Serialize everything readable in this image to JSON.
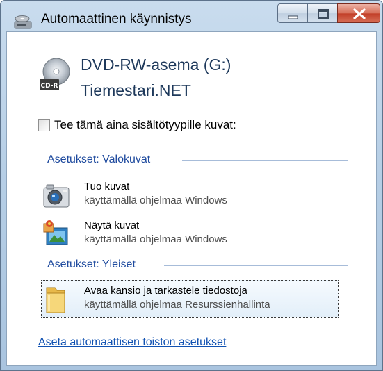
{
  "window": {
    "title": "Automaattinen käynnistys",
    "title_icon": "autoplay-icon",
    "buttons": {
      "minimize": "minimize-icon",
      "maximize": "maximize-icon",
      "close": "close-icon"
    }
  },
  "device": {
    "icon": "cd-r-disc-icon",
    "icon_badge": "CD-R",
    "drive_name": "DVD-RW-asema (G:)",
    "disc_name": "Tiemestari.NET"
  },
  "always_checkbox": {
    "label": "Tee tämä aina sisältötyypille kuvat:",
    "checked": false
  },
  "sections": [
    {
      "heading": "Asetukset: Valokuvat",
      "options": [
        {
          "icon": "camera-icon",
          "title": "Tuo kuvat",
          "subtitle": "käyttämällä ohjelmaa Windows"
        },
        {
          "icon": "photo-gallery-icon",
          "title": "Näytä kuvat",
          "subtitle": "käyttämällä ohjelmaa Windows"
        }
      ]
    },
    {
      "heading": "Asetukset: Yleiset",
      "options": [
        {
          "icon": "folder-icon",
          "title": "Avaa kansio ja tarkastele tiedostoja",
          "subtitle": "käyttämällä ohjelmaa Resurssienhallinta",
          "selected": true
        }
      ]
    }
  ],
  "footer_link": "Aseta automaattisen toiston asetukset",
  "colors": {
    "heading": "#1e4a9e",
    "link": "#1152b2",
    "device_text": "#1e395b",
    "frame": "#b7cfe6"
  }
}
